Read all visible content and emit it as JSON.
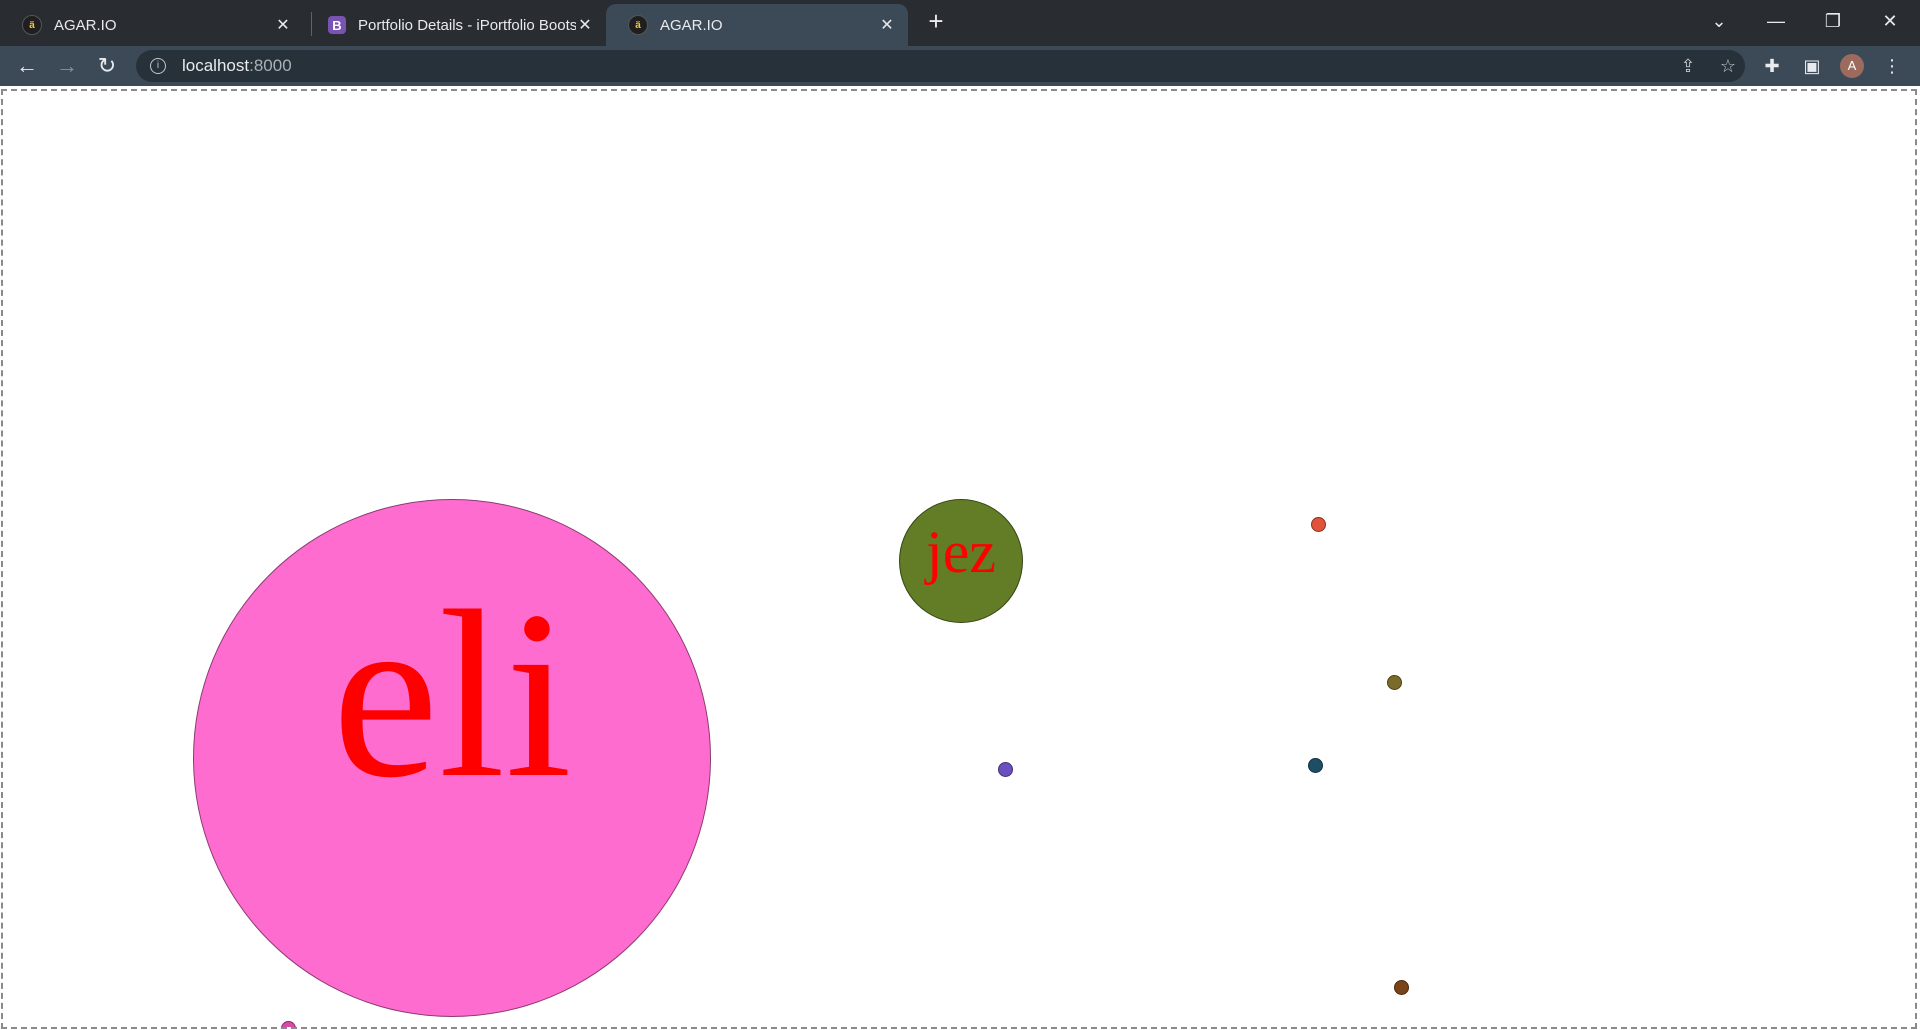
{
  "tabs": [
    {
      "title": "AGAR.IO",
      "favicon": "agar-icon",
      "active": false
    },
    {
      "title": "Portfolio Details - iPortfolio Bootstrap",
      "favicon": "bootstrap-icon",
      "active": false
    },
    {
      "title": "AGAR.IO",
      "favicon": "agar-icon",
      "active": true
    }
  ],
  "omnibox": {
    "host": "localhost",
    "port": ":8000"
  },
  "profile": {
    "initial": "A"
  },
  "players": [
    {
      "name": "eli",
      "color": "#ff6ccf"
    },
    {
      "name": "jez",
      "color": "#627d26"
    }
  ],
  "pellets": [
    {
      "color": "#e0533a"
    },
    {
      "color": "#7a6b2a"
    },
    {
      "color": "#6a4fbf"
    },
    {
      "color": "#1d4e66"
    },
    {
      "color": "#7a4318"
    },
    {
      "color": "#d94aa8"
    }
  ]
}
